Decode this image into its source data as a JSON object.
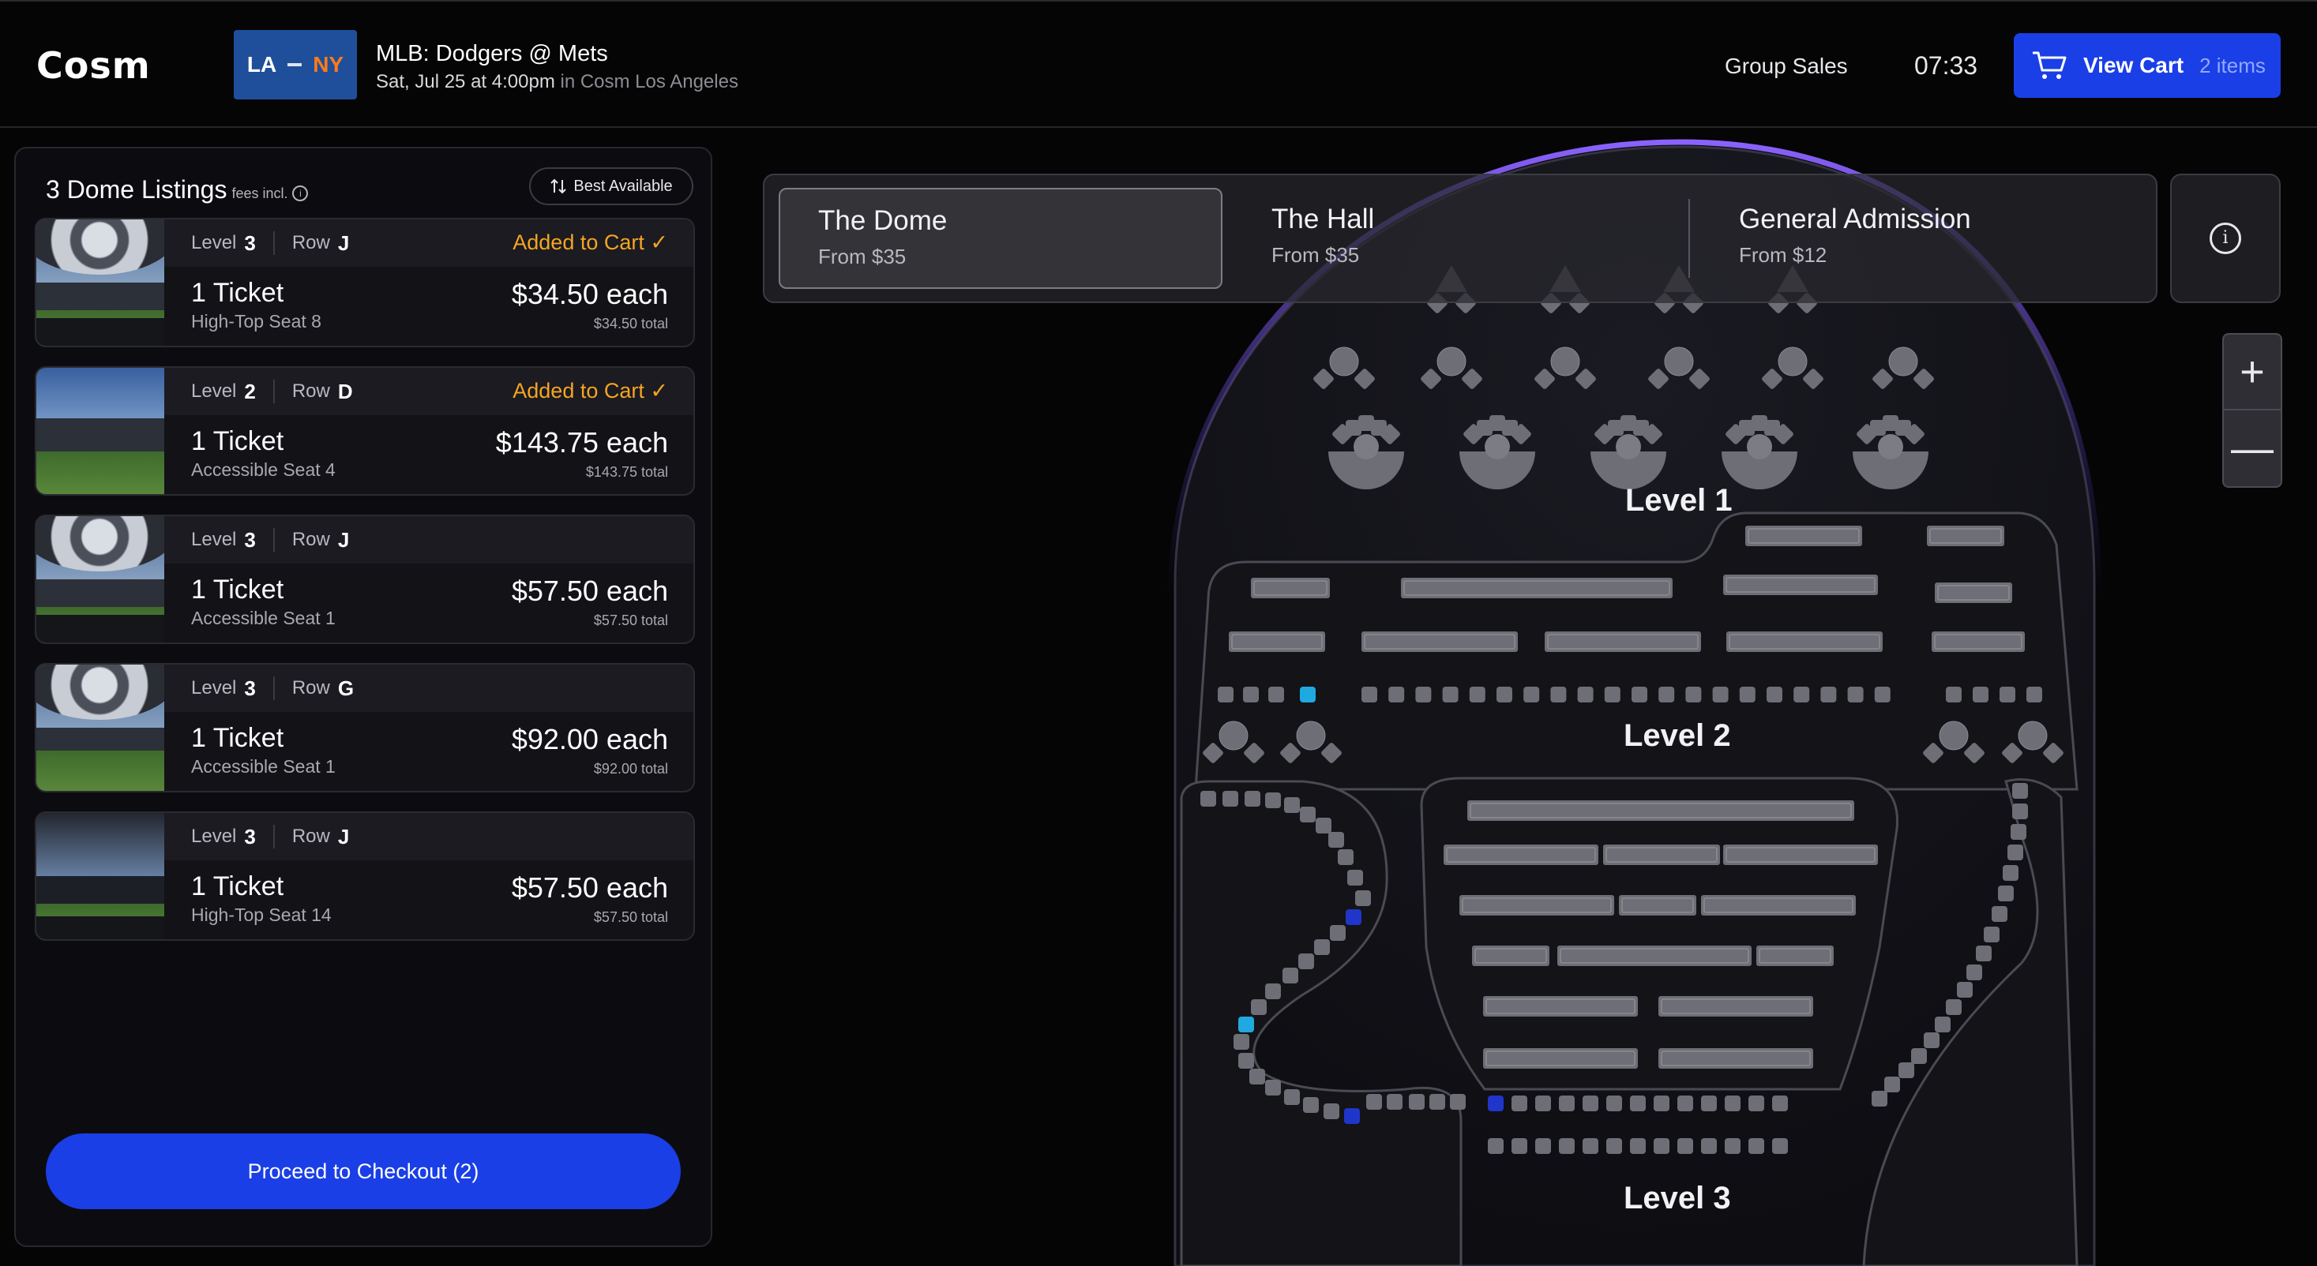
{
  "header": {
    "logo": "Cosm",
    "teams": {
      "away": "LA",
      "home": "NY"
    },
    "event_title": "MLB: Dodgers @ Mets",
    "event_datetime": "Sat, Jul 25 at 4:00pm",
    "event_venue": "in Cosm Los Angeles",
    "group_sales": "Group Sales",
    "timer": "07:33",
    "cart_label": "View Cart",
    "cart_count": "2 items"
  },
  "panel": {
    "title": "3 Dome Listings",
    "fees_note": "fees incl.",
    "info_icon": "i",
    "sort_label": "Best Available",
    "listings": [
      {
        "level_label": "Level",
        "level": "3",
        "row_label": "Row",
        "row": "J",
        "status": "Added to Cart ✓",
        "tickets": "1 Ticket",
        "seat": "High-Top Seat 8",
        "price": "$34.50 each",
        "total": "$34.50 total"
      },
      {
        "level_label": "Level",
        "level": "2",
        "row_label": "Row",
        "row": "D",
        "status": "Added to Cart ✓",
        "tickets": "1 Ticket",
        "seat": "Accessible Seat 4",
        "price": "$143.75 each",
        "total": "$143.75 total"
      },
      {
        "level_label": "Level",
        "level": "3",
        "row_label": "Row",
        "row": "J",
        "status": "",
        "tickets": "1 Ticket",
        "seat": "Accessible Seat 1",
        "price": "$57.50 each",
        "total": "$57.50 total"
      },
      {
        "level_label": "Level",
        "level": "3",
        "row_label": "Row",
        "row": "G",
        "status": "",
        "tickets": "1 Ticket",
        "seat": "Accessible Seat 1",
        "price": "$92.00 each",
        "total": "$92.00 total"
      },
      {
        "level_label": "Level",
        "level": "3",
        "row_label": "Row",
        "row": "J",
        "status": "",
        "tickets": "1 Ticket",
        "seat": "High-Top Seat 14",
        "price": "$57.50 each",
        "total": "$57.50 total"
      }
    ],
    "checkout": "Proceed to Checkout (2)"
  },
  "map": {
    "tabs": [
      {
        "name": "The Dome",
        "from": "From $35"
      },
      {
        "name": "The Hall",
        "from": "From $35"
      },
      {
        "name": "General Admission",
        "from": "From $12"
      }
    ],
    "info_icon": "i",
    "zoom_in": "+",
    "zoom_out": "—",
    "levels": [
      "Level 1",
      "Level 2",
      "Level 3"
    ],
    "colors": {
      "accent": "#1a3fe6",
      "added": "#f5a523",
      "seat": "#6e6e76",
      "seat_selected": "#1fa9e0",
      "seat_accessible": "#2035c9",
      "dome_glow": "#7a52f0"
    }
  }
}
